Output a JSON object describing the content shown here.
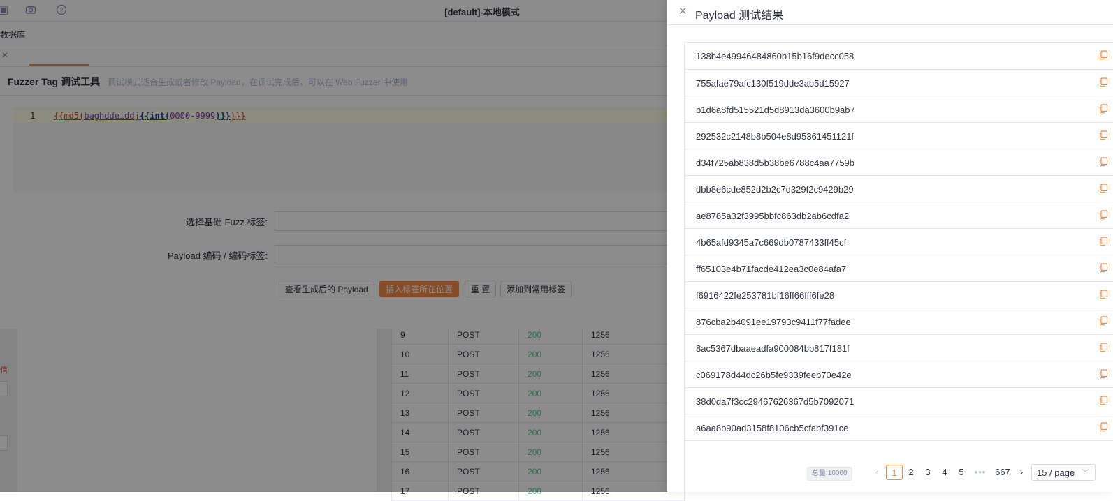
{
  "app": {
    "window_title": "[default]-本地模式",
    "menu_item": "数据库",
    "requests": [
      {
        "id": "9",
        "method": "POST",
        "status": "200",
        "length": "1256"
      },
      {
        "id": "10",
        "method": "POST",
        "status": "200",
        "length": "1256"
      },
      {
        "id": "11",
        "method": "POST",
        "status": "200",
        "length": "1256"
      },
      {
        "id": "12",
        "method": "POST",
        "status": "200",
        "length": "1256"
      },
      {
        "id": "13",
        "method": "POST",
        "status": "200",
        "length": "1256"
      },
      {
        "id": "14",
        "method": "POST",
        "status": "200",
        "length": "1256"
      },
      {
        "id": "15",
        "method": "POST",
        "status": "200",
        "length": "1256"
      },
      {
        "id": "16",
        "method": "POST",
        "status": "200",
        "length": "1256"
      },
      {
        "id": "17",
        "method": "POST",
        "status": "200",
        "length": "1256"
      }
    ],
    "left_red_text": "信"
  },
  "modal": {
    "title": "Fuzzer Tag 调试工具",
    "subtitle": "调试模式适合生成或者修改 Payload，在调试完成后，可以在 Web Fuzzer 中使用",
    "editor": {
      "line_number": "1",
      "tokens": {
        "open1": "{{md5(",
        "arg": "baghddeiddj",
        "open2": "{{int(",
        "range": "0000-9999",
        "close2": ")}}",
        "close1": ")}}"
      }
    },
    "fields": {
      "base_tag_label": "选择基础 Fuzz 标签:",
      "encode_label": "Payload 编码 / 编码标签:"
    },
    "buttons": {
      "view": "查看生成后的 Payload",
      "insert": "插入标签所在位置",
      "reset": "重 置",
      "add_common": "添加到常用标签"
    }
  },
  "drawer": {
    "title": "Payload 测试结果",
    "results": [
      "138b4e49946484860b15b16f9decc058",
      "755afae79afc130f519dde3ab5d15927",
      "b1d6a8fd515521d5d8913da3600b9ab7",
      "292532c2148b8b504e8d95361451121f",
      "d34f725ab838d5b38be6788c4aa7759b",
      "dbb8e6cde852d2b2c7d329f2c9429b29",
      "ae8785a32f3995bbfc863db2ab6cdfa2",
      "4b65afd9345a7c669db0787433ff45cf",
      "ff65103e4b71facde412ea3c0e84afa7",
      "f6916422fe253781bf16ff66fff6fe28",
      "876cba2b4091ee19793c9411f77fadee",
      "8ac5367dbaaeadfa900084bb817f181f",
      "c069178d44dc26b5fe9339feeb70e42e",
      "38d0da7f3cc29467626367d5b7092071",
      "a6aa8b90ad3158f8106cb5cfabf391ce"
    ],
    "pagination": {
      "total": "总量:10000",
      "pages": [
        "1",
        "2",
        "3",
        "4",
        "5"
      ],
      "ellipsis": "•••",
      "last": "667",
      "page_size": "15 / page",
      "current": "1"
    }
  },
  "colors": {
    "accent": "#f28b44",
    "status_ok": "#56c991",
    "overlay": "rgba(0,0,0,0.45)"
  }
}
